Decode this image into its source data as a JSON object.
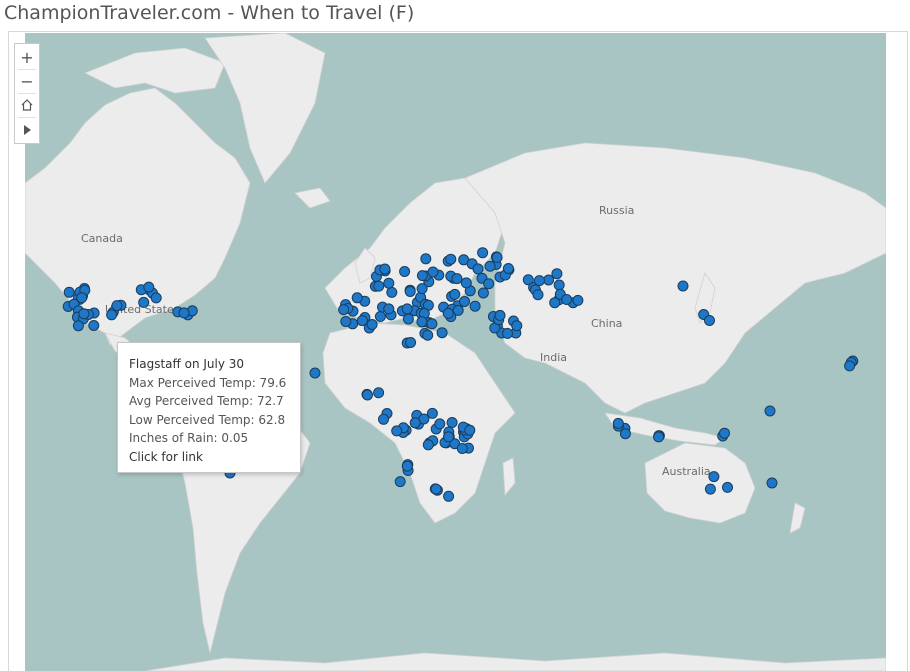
{
  "header": {
    "title": "ChampionTraveler.com - When to Travel (F)"
  },
  "map": {
    "water_color": "#a8c5c4",
    "land_color": "#ececec",
    "marker_color": "#1f77c8",
    "marker_stroke": "#1a3d5c",
    "labels": [
      "Canada",
      "United States",
      "Russia",
      "China",
      "India",
      "Australia"
    ]
  },
  "controls": {
    "zoom_in": "+",
    "zoom_out": "−",
    "home_icon": "home-icon",
    "play_icon": "play-icon"
  },
  "tooltip": {
    "title": "Flagstaff on July 30",
    "max_temp": "Max Perceived Temp: 79.6",
    "avg_temp": "Avg Perceived Temp: 72.7",
    "low_temp": "Low Perceived Temp: 62.8",
    "rain": "Inches of Rain: 0.05",
    "link": "Click for link"
  }
}
